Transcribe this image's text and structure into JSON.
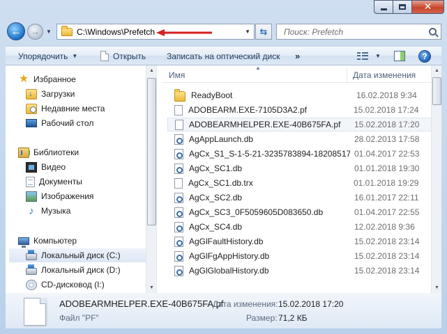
{
  "window": {
    "min_glyph": "",
    "close_glyph": "✕"
  },
  "nav": {
    "back_glyph": "←",
    "forward_glyph": "→",
    "address": "C:\\Windows\\Prefetch",
    "search_placeholder": "Поиск: Prefetch"
  },
  "toolbar": {
    "organize": "Упорядочить",
    "open": "Открыть",
    "burn": "Записать на оптический диск",
    "more": "»"
  },
  "sidebar": {
    "items": [
      {
        "label": "Избранное",
        "icon": "star-icon"
      },
      {
        "label": "Загрузки",
        "icon": "downloads-icon"
      },
      {
        "label": "Недавние места",
        "icon": "recent-places-icon"
      },
      {
        "label": "Рабочий стол",
        "icon": "desktop-icon"
      },
      {
        "label": "Библиотеки",
        "icon": "libraries-icon"
      },
      {
        "label": "Видео",
        "icon": "video-icon"
      },
      {
        "label": "Документы",
        "icon": "documents-icon"
      },
      {
        "label": "Изображения",
        "icon": "pictures-icon"
      },
      {
        "label": "Музыка",
        "icon": "music-icon"
      },
      {
        "label": "Компьютер",
        "icon": "computer-icon"
      },
      {
        "label": "Локальный диск (C:)",
        "icon": "hard-drive-icon"
      },
      {
        "label": "Локальный диск (D:)",
        "icon": "hard-drive-icon"
      },
      {
        "label": "CD-дисковод (I:)",
        "icon": "cd-drive-icon"
      }
    ]
  },
  "columns": {
    "name": "Имя",
    "date": "Дата изменения"
  },
  "files": [
    {
      "name": "ReadyBoot",
      "date": "16.02.2018 9:34",
      "type": "folder"
    },
    {
      "name": "ADOBEARM.EXE-7105D3A2.pf",
      "date": "15.02.2018 17:24",
      "type": "doc"
    },
    {
      "name": "ADOBEARMHELPER.EXE-40B675FA.pf",
      "date": "15.02.2018 17:20",
      "type": "doc"
    },
    {
      "name": "AgAppLaunch.db",
      "date": "28.02.2013 17:58",
      "type": "db"
    },
    {
      "name": "AgCx_S1_S-1-5-21-3235783894-18208517...",
      "date": "01.04.2017 22:53",
      "type": "db"
    },
    {
      "name": "AgCx_SC1.db",
      "date": "01.01.2018 19:30",
      "type": "db"
    },
    {
      "name": "AgCx_SC1.db.trx",
      "date": "01.01.2018 19:29",
      "type": "doc"
    },
    {
      "name": "AgCx_SC2.db",
      "date": "16.01.2017 22:11",
      "type": "db"
    },
    {
      "name": "AgCx_SC3_0F5059605D083650.db",
      "date": "01.04.2017 22:55",
      "type": "db"
    },
    {
      "name": "AgCx_SC4.db",
      "date": "12.02.2018 9:36",
      "type": "db"
    },
    {
      "name": "AgGlFaultHistory.db",
      "date": "15.02.2018 23:14",
      "type": "db"
    },
    {
      "name": "AgGlFgAppHistory.db",
      "date": "15.02.2018 23:14",
      "type": "db"
    },
    {
      "name": "AgGlGlobalHistory.db",
      "date": "15.02.2018 23:14",
      "type": "db"
    }
  ],
  "details": {
    "filename": "ADOBEARMHELPER.EXE-40B675FA.pf",
    "modified_label": "Дата изменения:",
    "modified_value": "15.02.2018 17:20",
    "type_text": "Файл \"PF\"",
    "size_label": "Размер:",
    "size_value": "71,2 КБ"
  },
  "colors": {
    "frame": "#b9d1ea",
    "annotation_arrow": "#d61f1f"
  }
}
